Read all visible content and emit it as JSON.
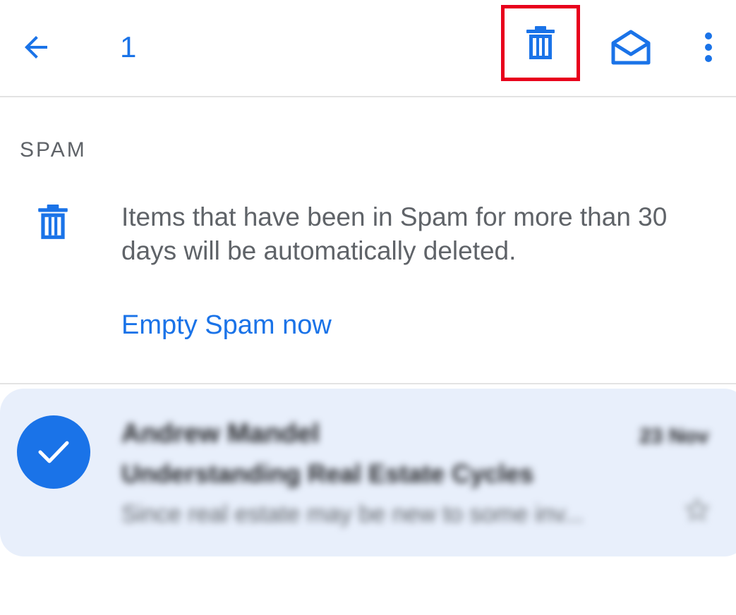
{
  "topbar": {
    "back_icon": "arrow-left-icon",
    "selected_count": "1",
    "delete_icon": "trash-icon",
    "mark_read_icon": "envelope-open-icon",
    "more_icon": "more-vert-icon"
  },
  "spam": {
    "header": "SPAM",
    "info_icon": "trash-icon",
    "info_text": "Items that have been in Spam for more than 30 days will be automatically deleted.",
    "empty_link": "Empty Spam now"
  },
  "message": {
    "selected": true,
    "sender": "Andrew Mandel",
    "date": "23 Nov",
    "subject": "Understanding Real Estate Cycles",
    "snippet": "Since real estate may be new to some inv...",
    "star_icon": "star-outline-icon"
  },
  "colors": {
    "accent": "#1a73e8",
    "highlight_box": "#e8001c",
    "selected_row_bg": "#e8effb"
  }
}
